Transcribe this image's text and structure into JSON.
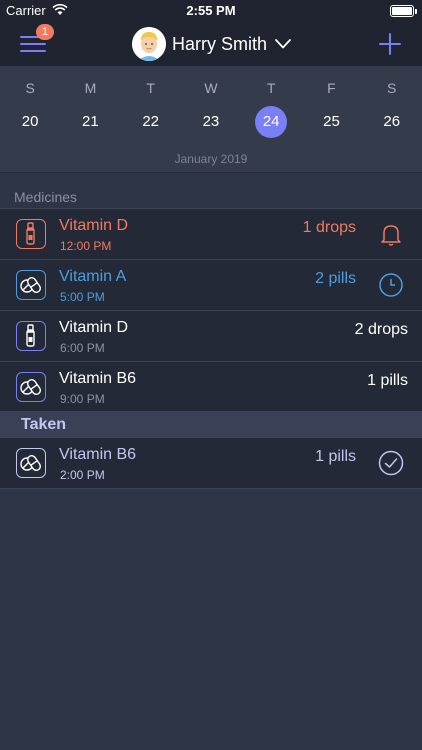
{
  "status_bar": {
    "carrier": "Carrier",
    "time": "2:55 PM"
  },
  "nav": {
    "badge_count": "1",
    "user_name": "Harry Smith"
  },
  "calendar": {
    "day_letters": [
      "S",
      "M",
      "T",
      "W",
      "T",
      "F",
      "S"
    ],
    "day_numbers": [
      "20",
      "21",
      "22",
      "23",
      "24",
      "25",
      "26"
    ],
    "selected_day": "24",
    "month_label": "January 2019"
  },
  "sections": {
    "medicines": "Medicines",
    "taken": "Taken"
  },
  "medicines": [
    {
      "name": "Vitamin D",
      "time": "12:00 PM",
      "amount": "1 drops",
      "icon": "dropper-icon",
      "status_icon": "bell-icon",
      "color": "#f07b5e"
    },
    {
      "name": "Vitamin A",
      "time": "5:00 PM",
      "amount": "2 pills",
      "icon": "pills-icon",
      "status_icon": "clock-icon",
      "color": "#4d9ee0"
    },
    {
      "name": "Vitamin D",
      "time": "6:00 PM",
      "amount": "2 drops",
      "icon": "dropper-icon",
      "status_icon": "",
      "color": "#ffffff"
    },
    {
      "name": "Vitamin B6",
      "time": "9:00 PM",
      "amount": "1 pills",
      "icon": "pills-icon",
      "status_icon": "",
      "color": "#ffffff"
    }
  ],
  "taken": [
    {
      "name": "Vitamin B6",
      "time": "2:00 PM",
      "amount": "1 pills",
      "icon": "pills-icon",
      "status_icon": "check-icon",
      "color": "#c3c7f0"
    }
  ],
  "colors": {
    "accent": "#7b7ff5",
    "alert": "#f07b5e",
    "upcoming": "#4d9ee0",
    "taken": "#c3c7f0"
  }
}
